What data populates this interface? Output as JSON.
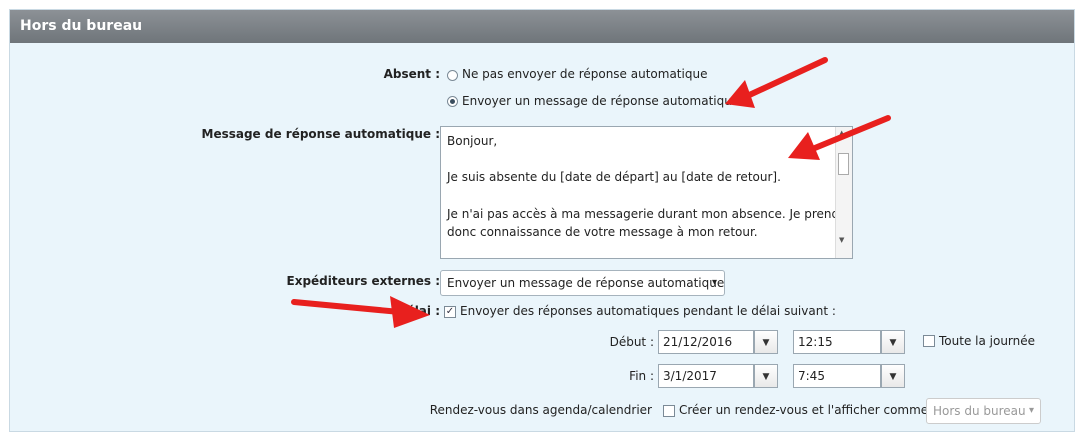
{
  "header": {
    "title": "Hors du bureau"
  },
  "absent": {
    "label": "Absent :",
    "options": [
      {
        "label": "Ne pas envoyer de réponse automatique",
        "selected": false
      },
      {
        "label": "Envoyer un message de réponse automatique",
        "selected": true
      }
    ]
  },
  "auto_reply": {
    "label": "Message de réponse automatique :",
    "lines": [
      "Bonjour,",
      "Je suis absente du [date de départ] au [date de retour].",
      "Je n'ai pas accès à ma messagerie durant mon absence. Je prendrai",
      "donc connaissance de votre message à mon retour."
    ]
  },
  "external": {
    "label": "Expéditeurs externes :",
    "value": "Envoyer un message de réponse automatique"
  },
  "delay": {
    "label": "Délai :",
    "checkbox_label": "Envoyer des réponses automatiques pendant le délai suivant :",
    "checked": true,
    "start_label": "Début :",
    "start_date": "21/12/2016",
    "start_time": "12:15",
    "all_day_label": "Toute la journée",
    "end_label": "Fin :",
    "end_date": "3/1/2017",
    "end_time": "7:45"
  },
  "calendar": {
    "label": "Rendez-vous dans agenda/calendrier",
    "checkbox_label": "Créer un rendez-vous et l'afficher comme :",
    "value": "Hors du bureau"
  },
  "colors": {
    "annotation_arrow": "#e8201e",
    "header_bg": "#7b8186",
    "panel_bg": "#eaf5fb"
  },
  "icons": {
    "dropdown": "▾",
    "check": "✓"
  }
}
